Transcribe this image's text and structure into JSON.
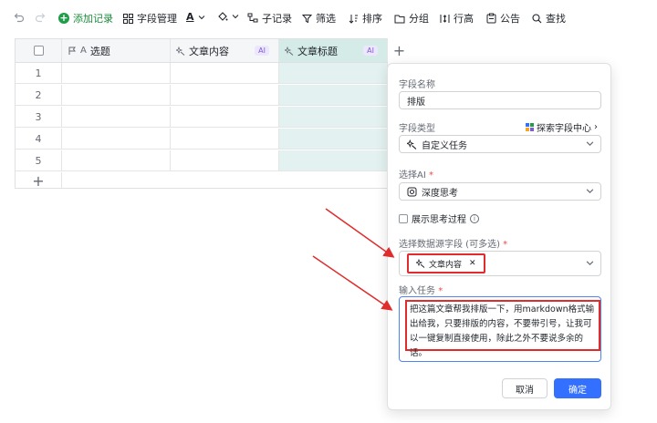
{
  "toolbar": {
    "add_record": "添加记录",
    "field_manage": "字段管理",
    "text_format": "A",
    "sub_record": "子记录",
    "filter": "筛选",
    "sort": "排序",
    "group": "分组",
    "row_height": "行高",
    "notice": "公告",
    "search": "查找"
  },
  "table": {
    "columns": [
      {
        "label": "选题",
        "icon": "flag-icon",
        "ai": ""
      },
      {
        "label": "文章内容",
        "icon": "ai-sparkle-icon",
        "ai": "AI"
      },
      {
        "label": "文章标题",
        "icon": "ai-sparkle-icon",
        "ai": "AI"
      }
    ],
    "rows": [
      "1",
      "2",
      "3",
      "4",
      "5"
    ],
    "add_row": "+",
    "add_col": "+"
  },
  "panel": {
    "field_name_label": "字段名称",
    "field_name_value": "排版",
    "field_type_label": "字段类型",
    "explore_link": "探索字段中心",
    "field_type_value": "自定义任务",
    "select_ai_label": "选择AI",
    "select_ai_value": "深度思考",
    "show_thinking": "展示思考过程",
    "source_label": "选择数据源字段 (可多选)",
    "source_tag": "文章内容",
    "task_label": "输入任务",
    "task_text": "把这篇文章帮我排版一下，用markdown格式输出给我，只要排版的内容，不要带引号，让我可以一键复制直接使用，除此之外不要说多余的话。",
    "cancel": "取消",
    "confirm": "确定",
    "required_mark": "*"
  },
  "colors": {
    "accent": "#3370ff",
    "highlight": "#e02c2c",
    "selected_column": "#e3f2f0",
    "add_green": "#1f9d48"
  }
}
